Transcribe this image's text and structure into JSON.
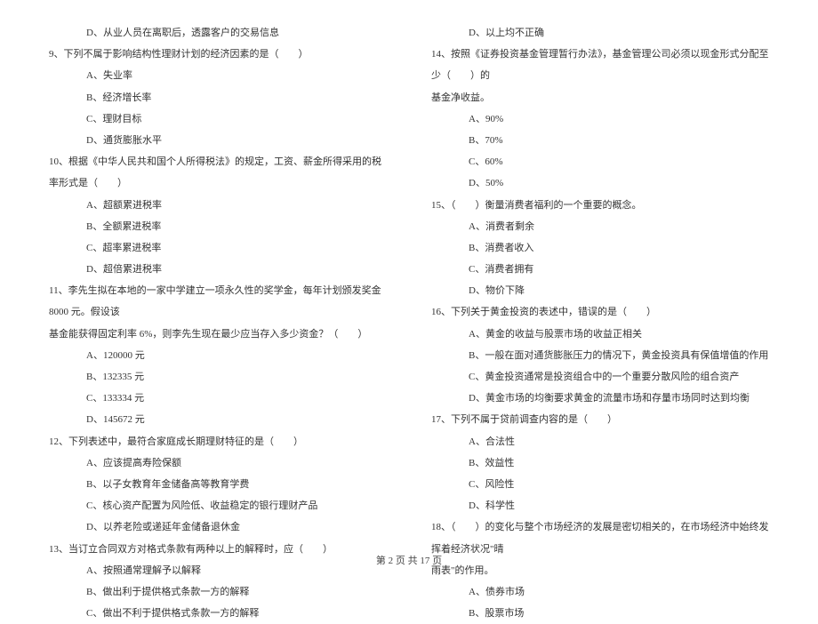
{
  "left": {
    "q8_optD": "D、从业人员在离职后，透露客户的交易信息",
    "q9": "9、下列不属于影响结构性理财计划的经济因素的是（　　）",
    "q9_optA": "A、失业率",
    "q9_optB": "B、经济增长率",
    "q9_optC": "C、理财目标",
    "q9_optD": "D、通货膨胀水平",
    "q10": "10、根据《中华人民共和国个人所得税法》的规定，工资、薪金所得采用的税率形式是（　　）",
    "q10_optA": "A、超额累进税率",
    "q10_optB": "B、全额累进税率",
    "q10_optC": "C、超率累进税率",
    "q10_optD": "D、超倍累进税率",
    "q11": "11、李先生拟在本地的一家中学建立一项永久性的奖学金，每年计划颁发奖金 8000 元。假设该",
    "q11_cont": "基金能获得固定利率 6%，则李先生现在最少应当存入多少资金？（　　）",
    "q11_optA": "A、120000 元",
    "q11_optB": "B、132335 元",
    "q11_optC": "C、133334 元",
    "q11_optD": "D、145672 元",
    "q12": "12、下列表述中，最符合家庭成长期理财特征的是（　　）",
    "q12_optA": "A、应该提高寿险保额",
    "q12_optB": "B、以子女教育年金储备高等教育学费",
    "q12_optC": "C、核心资产配置为风险低、收益稳定的银行理财产品",
    "q12_optD": "D、以养老险或递延年金储备退休金",
    "q13": "13、当订立合同双方对格式条款有两种以上的解释时，应（　　）",
    "q13_optA": "A、按照通常理解予以解释",
    "q13_optB": "B、做出利于提供格式条款一方的解释",
    "q13_optC": "C、做出不利于提供格式条款一方的解释"
  },
  "right": {
    "q13_optD": "D、以上均不正确",
    "q14": "14、按照《证券投资基金管理暂行办法》，基金管理公司必须以现金形式分配至少（　　）的",
    "q14_cont": "基金净收益。",
    "q14_optA": "A、90%",
    "q14_optB": "B、70%",
    "q14_optC": "C、60%",
    "q14_optD": "D、50%",
    "q15": "15、（　　）衡量消费者福利的一个重要的概念。",
    "q15_optA": "A、消费者剩余",
    "q15_optB": "B、消费者收入",
    "q15_optC": "C、消费者拥有",
    "q15_optD": "D、物价下降",
    "q16": "16、下列关于黄金投资的表述中，错误的是（　　）",
    "q16_optA": "A、黄金的收益与股票市场的收益正相关",
    "q16_optB": "B、一般在面对通货膨胀压力的情况下，黄金投资具有保值增值的作用",
    "q16_optC": "C、黄金投资通常是投资组合中的一个重要分散风险的组合资产",
    "q16_optD": "D、黄金市场的均衡要求黄金的流量市场和存量市场同时达到均衡",
    "q17": "17、下列不属于贷前调查内容的是（　　）",
    "q17_optA": "A、合法性",
    "q17_optB": "B、效益性",
    "q17_optC": "C、风险性",
    "q17_optD": "D、科学性",
    "q18": "18、（　　）的变化与整个市场经济的发展是密切相关的，在市场经济中始终发挥着经济状况\"晴",
    "q18_cont": "雨表\"的作用。",
    "q18_optA": "A、债券市场",
    "q18_optB": "B、股票市场"
  },
  "footer": "第 2 页 共 17 页"
}
